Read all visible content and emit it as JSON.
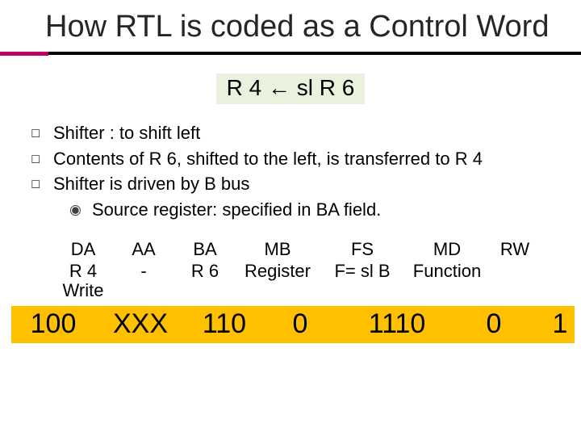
{
  "title": "How RTL is coded as a Control Word",
  "rtl": "R 4 ← sl R 6",
  "bullets": [
    "Shifter : to shift left",
    "Contents of R 6, shifted to the left, is transferred to R 4",
    "Shifter is driven by B bus"
  ],
  "sub_bullet": "Source register: specified in BA field.",
  "table": {
    "headers": [
      "DA",
      "AA",
      "BA",
      "MB",
      "FS",
      "MD",
      "RW"
    ],
    "values": [
      "R 4",
      "-",
      "R 6",
      "Register",
      "F= sl B",
      "Function",
      ""
    ],
    "extra": [
      "Write"
    ]
  },
  "code": [
    "100",
    "XXX",
    "110",
    "0",
    "1110",
    "0",
    "1"
  ]
}
